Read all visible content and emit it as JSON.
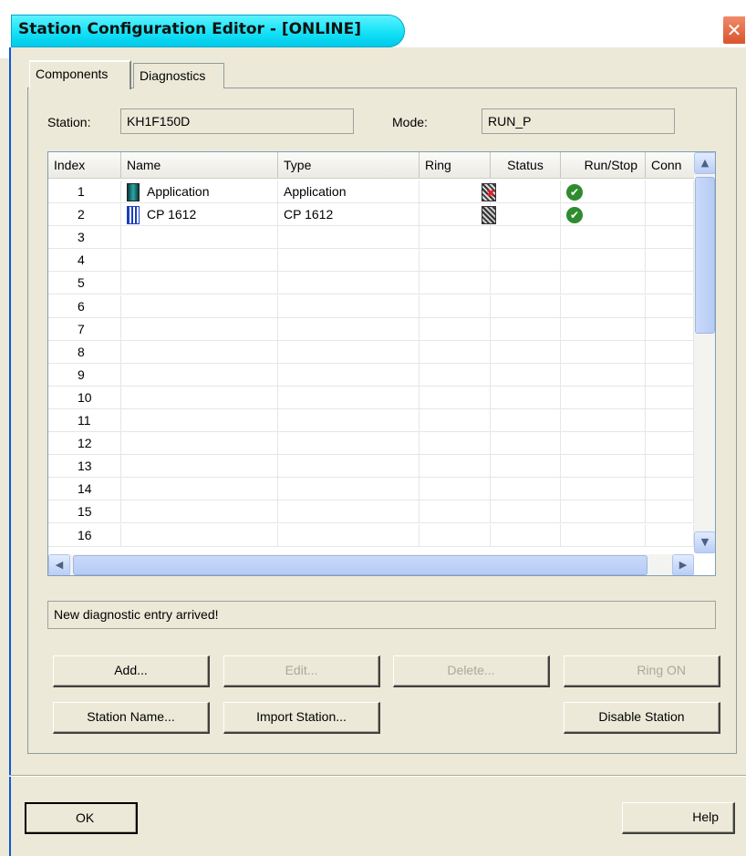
{
  "window": {
    "title": "Station Configuration Editor - [ONLINE]"
  },
  "tabs": [
    {
      "label": "Components"
    },
    {
      "label": "Diagnostics"
    }
  ],
  "station": {
    "label": "Station:",
    "value": "KH1F150D"
  },
  "mode": {
    "label": "Mode:",
    "value": "RUN_P"
  },
  "table": {
    "columns": [
      "Index",
      "Name",
      "Type",
      "Ring",
      "Status",
      "Run/Stop",
      "Conn"
    ],
    "rows": [
      {
        "index": "1",
        "name": "Application",
        "type": "Application"
      },
      {
        "index": "2",
        "name": "CP 1612",
        "type": "CP 1612"
      },
      {
        "index": "3"
      },
      {
        "index": "4"
      },
      {
        "index": "5"
      },
      {
        "index": "6"
      },
      {
        "index": "7"
      },
      {
        "index": "8"
      },
      {
        "index": "9"
      },
      {
        "index": "10"
      },
      {
        "index": "11"
      },
      {
        "index": "12"
      },
      {
        "index": "13"
      },
      {
        "index": "14"
      },
      {
        "index": "15"
      },
      {
        "index": "16"
      }
    ]
  },
  "status_message": "New diagnostic entry arrived!",
  "buttons": {
    "add": "Add...",
    "edit": "Edit...",
    "delete": "Delete...",
    "ring_on": "Ring ON",
    "station_name": "Station Name...",
    "import_station": "Import Station...",
    "disable_station": "Disable Station",
    "ok": "OK",
    "help": "Help"
  },
  "colors": {
    "title_accent": "#14e2f6",
    "close": "#d9542c",
    "ok_icon": "#2e8b2e"
  }
}
